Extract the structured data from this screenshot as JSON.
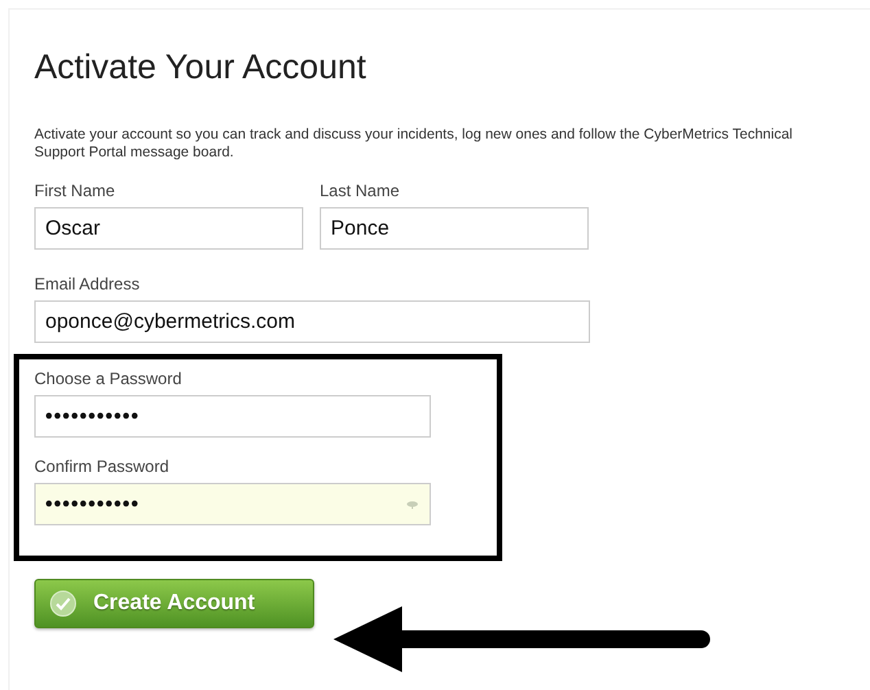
{
  "title": "Activate Your Account",
  "description": "Activate your account so you can track and discuss your incidents, log new ones and follow the CyberMetrics Technical Support Portal message board.",
  "name_fields": [
    {
      "label": "First Name",
      "value": "Oscar"
    },
    {
      "label": "Last Name",
      "value": "Ponce"
    }
  ],
  "email_field": {
    "label": "Email Address",
    "value": "oponce@cybermetrics.com"
  },
  "password_fields": [
    {
      "label": "Choose a Password",
      "value": "•••••••••••",
      "focused": false
    },
    {
      "label": "Confirm Password",
      "value": "•••••••••••",
      "focused": true
    }
  ],
  "submit_button": {
    "label": "Create Account"
  }
}
